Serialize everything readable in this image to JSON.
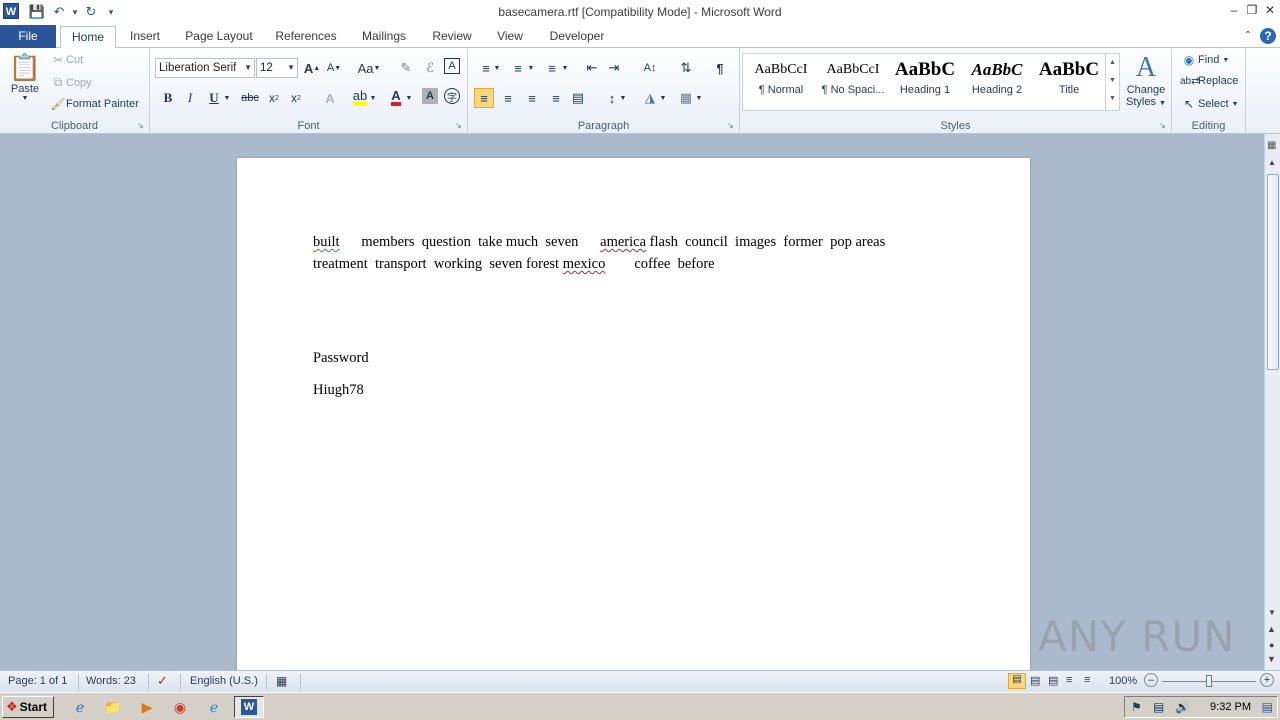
{
  "window": {
    "title": "basecamera.rtf [Compatibility Mode] - Microsoft Word",
    "app_icon_letter": "W"
  },
  "tabs": [
    "File",
    "Home",
    "Insert",
    "Page Layout",
    "References",
    "Mailings",
    "Review",
    "View",
    "Developer"
  ],
  "active_tab": "Home",
  "ribbon": {
    "clipboard": {
      "label": "Clipboard",
      "paste": "Paste",
      "cut": "Cut",
      "copy": "Copy",
      "format_painter": "Format Painter"
    },
    "font": {
      "label": "Font",
      "font_name": "Liberation Serif",
      "font_size": "12"
    },
    "paragraph": {
      "label": "Paragraph"
    },
    "styles": {
      "label": "Styles",
      "items": [
        {
          "sample": "AaBbCcI",
          "name": "¶ Normal"
        },
        {
          "sample": "AaBbCcI",
          "name": "¶ No Spaci..."
        },
        {
          "sample": "AaBbC",
          "name": "Heading 1"
        },
        {
          "sample": "AaBbC",
          "name": "Heading 2"
        },
        {
          "sample": "AaBbC",
          "name": "Title"
        }
      ],
      "change_styles": [
        "Change",
        "Styles"
      ]
    },
    "editing": {
      "label": "Editing",
      "find": "Find",
      "replace": "Replace",
      "select": "Select"
    }
  },
  "document": {
    "line1_words": [
      "built",
      "members",
      "question",
      "take",
      "much",
      "seven",
      "america",
      "flash",
      "council",
      "images",
      "former",
      "pop",
      "areas"
    ],
    "line2_words": [
      "treatment",
      "transport",
      "working",
      "seven",
      "forest",
      "mexico",
      "coffee",
      "before"
    ],
    "password_label": "Password",
    "password_value": "Hiugh78"
  },
  "statusbar": {
    "page": "Page: 1 of 1",
    "words": "Words: 23",
    "language": "English (U.S.)",
    "zoom": "100%"
  },
  "taskbar": {
    "start": "Start",
    "clock": "9:32 PM"
  },
  "watermark": "ANY RUN"
}
